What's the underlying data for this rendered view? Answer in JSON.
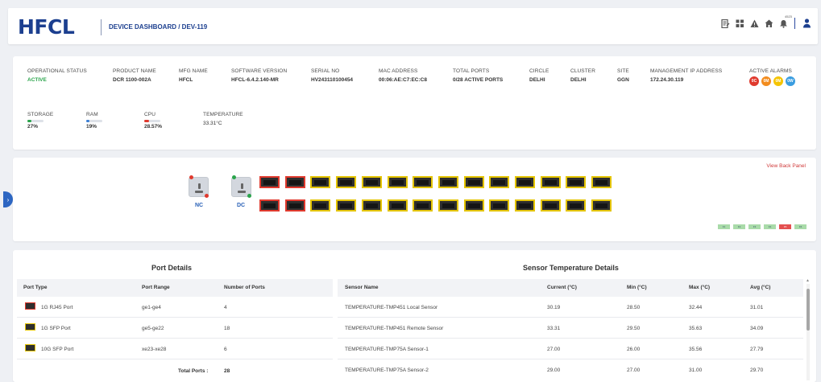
{
  "header": {
    "logo": "HFCL",
    "title": "DEVICE DASHBOARD / DEV-119",
    "notification_count": "4523"
  },
  "info": {
    "fields": [
      {
        "label": "OPERATIONAL STATUS",
        "value": "ACTIVE"
      },
      {
        "label": "PRODUCT NAME",
        "value": "DCR 1100-002A"
      },
      {
        "label": "MFG NAME",
        "value": "HFCL"
      },
      {
        "label": "SOFTWARE VERSION",
        "value": "HFCL-6.4.2.140-MR"
      },
      {
        "label": "SERIAL NO",
        "value": "HV243110100454"
      },
      {
        "label": "MAC ADDRESS",
        "value": "00:06:AE:C7:EC:C8"
      },
      {
        "label": "TOTAL PORTS",
        "value": "0/28 ACTIVE PORTS"
      },
      {
        "label": "CIRCLE",
        "value": "DELHI"
      },
      {
        "label": "CLUSTER",
        "value": "DELHI"
      },
      {
        "label": "SITE",
        "value": "GGN"
      },
      {
        "label": "MANAGEMENT IP ADDRESS",
        "value": "172.24.30.119"
      }
    ],
    "alarms": {
      "label": "ACTIVE ALARMS",
      "items": [
        {
          "code": "0C",
          "color": "#e03a2e"
        },
        {
          "code": "0M",
          "color": "#f28c1e"
        },
        {
          "code": "0M",
          "color": "#f5c400"
        },
        {
          "code": "0W",
          "color": "#3a9de0"
        }
      ]
    },
    "metrics": [
      {
        "label": "STORAGE",
        "value": "27%",
        "fraction": 0.27,
        "color": "#2aa44b"
      },
      {
        "label": "RAM",
        "value": "19%",
        "fraction": 0.19,
        "color": "#3a7fd5"
      },
      {
        "label": "CPU",
        "value": "28.57%",
        "fraction": 0.2857,
        "color": "#e03a2e"
      }
    ],
    "temperature": {
      "label": "TEMPERATURE",
      "value": "33.31°C"
    }
  },
  "panel": {
    "view_back": "View Back Panel",
    "psu": [
      {
        "label": "NC",
        "dot_color": "#e03a2e"
      },
      {
        "label": "DC",
        "dot_color": "#2aa44b"
      }
    ],
    "top_row": [
      "rj45",
      "rj45",
      "sfp",
      "sfp",
      "sfp",
      "sfp",
      "sfp",
      "sfp",
      "sfp",
      "sfp",
      "sfp",
      "sfp",
      "sfp",
      "sfp"
    ],
    "bottom_row": [
      "rj45",
      "rj45",
      "sfp",
      "sfp",
      "sfp",
      "sfp",
      "sfp",
      "sfp",
      "sfp",
      "sfp",
      "sfp",
      "sfp",
      "sfp",
      "sfp"
    ],
    "legend": [
      "F1",
      "F2",
      "F3",
      "F4",
      "F5",
      "F6"
    ]
  },
  "port_details": {
    "title": "Port Details",
    "headers": [
      "Port Type",
      "Port Range",
      "Number of Ports"
    ],
    "rows": [
      {
        "type": "1G RJ45 Port",
        "range": "ge1-ge4",
        "count": "4",
        "kind": "rj45"
      },
      {
        "type": "1G SFP Port",
        "range": "ge5-ge22",
        "count": "18",
        "kind": "sfp"
      },
      {
        "type": "10G SFP Port",
        "range": "xe23-xe28",
        "count": "6",
        "kind": "sfp"
      }
    ],
    "total_label": "Total Ports :",
    "total_value": "28"
  },
  "sensor_details": {
    "title": "Sensor Temperature Details",
    "headers": [
      "Sensor Name",
      "Current (°C)",
      "Min (°C)",
      "Max (°C)",
      "Avg (°C)"
    ],
    "rows": [
      [
        "TEMPERATURE-TMP451 Local Sensor",
        "30.19",
        "28.50",
        "32.44",
        "31.01"
      ],
      [
        "TEMPERATURE-TMP451 Remote Sensor",
        "33.31",
        "29.50",
        "35.63",
        "34.09"
      ],
      [
        "TEMPERATURE-TMP75A Sensor-1",
        "27.00",
        "26.00",
        "35.56",
        "27.79"
      ],
      [
        "TEMPERATURE-TMP75A Sensor-2",
        "29.00",
        "27.00",
        "31.00",
        "29.70"
      ]
    ]
  }
}
